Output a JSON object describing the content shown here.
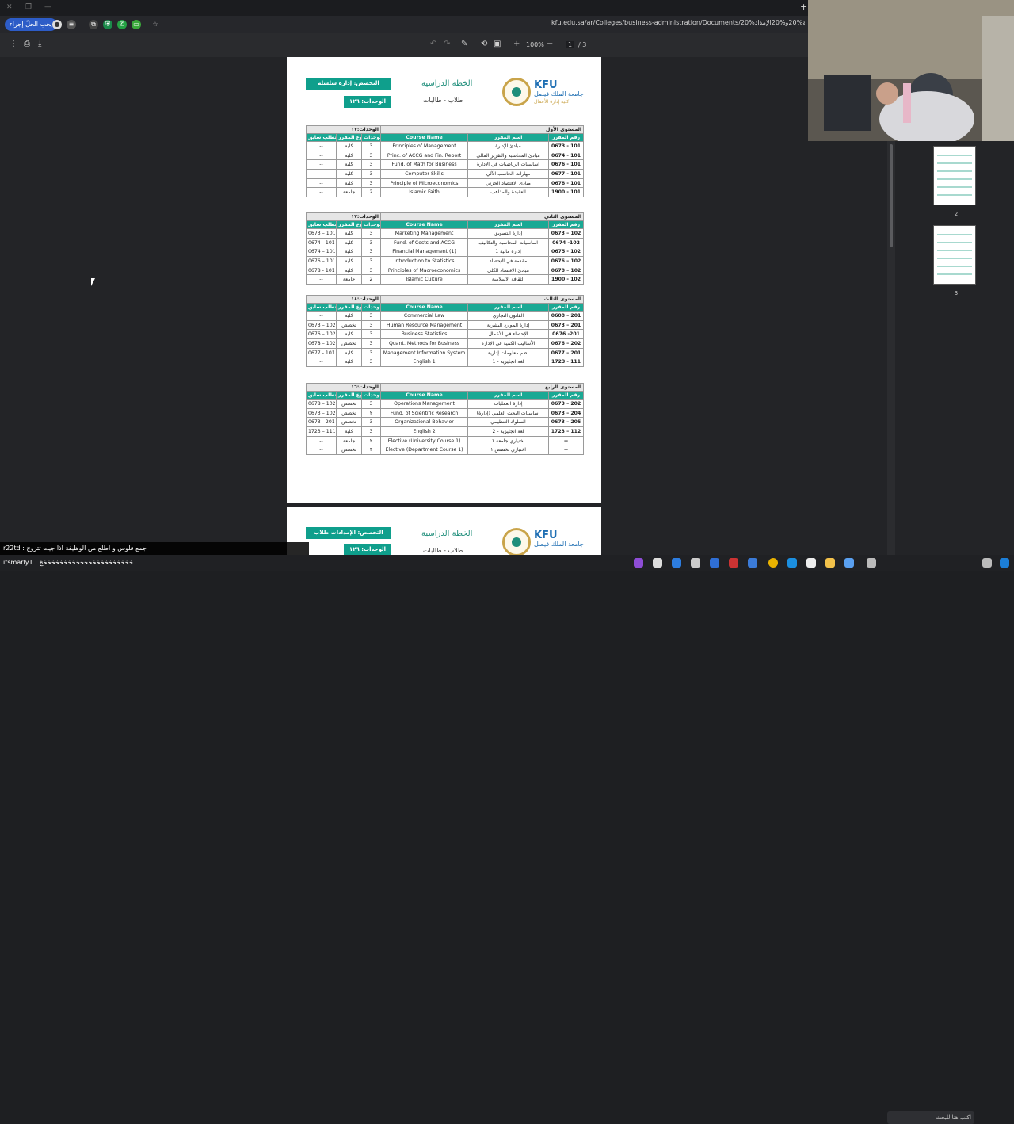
{
  "browser": {
    "tab_plus": "+",
    "url": "kfu.edu.sa/ar/Colleges/business-administration/Documents/الاعتماد%20خطة%20و%20الإمداد%20...",
    "pill_label": "يجب الحلّ إجراء",
    "star": "☆"
  },
  "pdf_toolbar": {
    "zoom": "100%",
    "page_current": "1",
    "page_total": "/ 3",
    "plus": "+",
    "minus": "−"
  },
  "page1": {
    "logo_en": "KFU",
    "logo_ar": "جامعة الملك فيصل",
    "logo_ar_sub": "كلية إدارة الأعمال",
    "plan_title": "الخطة الدراسية",
    "plan_sub": "طلاب - طالبات",
    "specialization": "التخصص: إدارة سلسلة الإمدادات",
    "units": "الوحدات: ١٢٦"
  },
  "col_headers": {
    "code": "رقم المقرر",
    "name_ar": "اسم المقرر",
    "name_en": "Course Name",
    "units": "الوحدات",
    "type": "نوع المقرر",
    "prereq": "متطلب سابق"
  },
  "levels": [
    {
      "title": "المستوى الأول",
      "units": "الوحدات:١٧",
      "rows": [
        {
          "code": "0673 - 101",
          "ar": "مبادئ الإدارة",
          "en": "Principles of Management",
          "u": "3",
          "type": "كلية",
          "pre": "--"
        },
        {
          "code": "0674 - 101",
          "ar": "مبادئ المحاسبة والتقرير المالي",
          "en": "Princ. of ACCG and Fin. Report",
          "u": "3",
          "type": "كلية",
          "pre": "--"
        },
        {
          "code": "0676 - 101",
          "ar": "اساسيات الرياضيات في الادارة",
          "en": "Fund. of Math for Business",
          "u": "3",
          "type": "كلية",
          "pre": "--"
        },
        {
          "code": "0677 - 101",
          "ar": "مهارات الحاسب الآلي",
          "en": "Computer Skills",
          "u": "3",
          "type": "كلية",
          "pre": "--"
        },
        {
          "code": "0678 - 101",
          "ar": "مبادئ الاقتصاد الجزئي",
          "en": "Principle of Microeconomics",
          "u": "3",
          "type": "كلية",
          "pre": "--"
        },
        {
          "code": "1900 - 101",
          "ar": "العقيدة والمذاهب",
          "en": "Islamic Faith",
          "u": "2",
          "type": "جامعة",
          "pre": "--"
        }
      ]
    },
    {
      "title": "المستوى الثاني",
      "units": "الوحدات:١٧",
      "rows": [
        {
          "code": "0673 – 102",
          "ar": "إدارة التسويق",
          "en": "Marketing Management",
          "u": "3",
          "type": "كلية",
          "pre": "0673 – 101"
        },
        {
          "code": "0674 -102",
          "ar": "اساسيات المحاسبة والتكاليف",
          "en": "Fund. of Costs and ACCG",
          "u": "3",
          "type": "كلية",
          "pre": "0674 - 101"
        },
        {
          "code": "0675 - 102",
          "ar": "إدارة مالية 1",
          "en": "Financial Management (1)",
          "u": "3",
          "type": "كلية",
          "pre": "0674 – 101"
        },
        {
          "code": "0676 – 102",
          "ar": "مقدمة في الإحصاء",
          "en": "Introduction to Statistics",
          "u": "3",
          "type": "كلية",
          "pre": "0676 – 101"
        },
        {
          "code": "0678 – 102",
          "ar": "مبادئ الاقتصاد الكلي",
          "en": "Principles of Macroeconomics",
          "u": "3",
          "type": "كلية",
          "pre": "0678 - 101"
        },
        {
          "code": "1900 - 102",
          "ar": "الثقافة الاسلامية",
          "en": "Islamic Culture",
          "u": "2",
          "type": "جامعة",
          "pre": "--"
        }
      ]
    },
    {
      "title": "المستوى الثالث",
      "units": "الوحدات:١٨",
      "rows": [
        {
          "code": "0608 – 201",
          "ar": "القانون التجاري",
          "en": "Commercial Law",
          "u": "3",
          "type": "كلية",
          "pre": "--"
        },
        {
          "code": "0673 – 201",
          "ar": "إدارة الموارد البشرية",
          "en": "Human Resource Management",
          "u": "3",
          "type": "تخصص",
          "pre": "0673 – 102"
        },
        {
          "code": "0676 -201",
          "ar": "الإحصاء في الأعمال",
          "en": "Business Statistics",
          "u": "3",
          "type": "كلية",
          "pre": "0676 – 102"
        },
        {
          "code": "0676 – 202",
          "ar": "الأساليب الكمية في الإدارة",
          "en": "Quant. Methods for Business",
          "u": "3",
          "type": "تخصص",
          "pre": "0678 – 102"
        },
        {
          "code": "0677 – 201",
          "ar": "نظم معلومات إدارية",
          "en": "Management Information System",
          "u": "3",
          "type": "كلية",
          "pre": "0677 - 101"
        },
        {
          "code": "1723 - 111",
          "ar": "لغة انجليزية - 1",
          "en": "English 1",
          "u": "3",
          "type": "كلية",
          "pre": "--"
        }
      ]
    },
    {
      "title": "المستوى الرابع",
      "units": "الوحدات:١٦",
      "rows": [
        {
          "code": "0673 – 202",
          "ar": "إدارة العمليات",
          "en": "Operations Management",
          "u": "3",
          "type": "تخصص",
          "pre": "0678 – 102"
        },
        {
          "code": "0673 – 204",
          "ar": "اساسيات البحث العلمي (إدارة)",
          "en": "Fund. of Scientific Research",
          "u": "٢",
          "type": "تخصص",
          "pre": "0673 – 102"
        },
        {
          "code": "0673 – 205",
          "ar": "السلوك التنظيمي",
          "en": "Organizational Behavior",
          "u": "3",
          "type": "تخصص",
          "pre": "0673 - 201"
        },
        {
          "code": "1723 – 112",
          "ar": "لغة انجليزية - 2",
          "en": "English  2",
          "u": "3",
          "type": "كلية",
          "pre": "1723 – 111"
        },
        {
          "code": "--",
          "ar": "اختياري جامعة ١",
          "en": "Elective (University Course 1)",
          "u": "٢",
          "type": "جامعة",
          "pre": "--"
        },
        {
          "code": "--",
          "ar": "اختياري تخصص ١",
          "en": "Elective (Department Course 1)",
          "u": "٣",
          "type": "تخصص",
          "pre": "--"
        }
      ]
    }
  ],
  "page2": {
    "specialization": "التخصص: الإمدادات طلاب",
    "units": "الوحدات: ١٢٦"
  },
  "thumbnails": [
    {
      "label": "2"
    },
    {
      "label": "3"
    }
  ],
  "chat": {
    "line1": "r22td : جمع فلوس و اطلع من الوظيفة اذا جيت تتزوج",
    "line2": "itsmarly1 : خخخخخخخخخخخخخخخخخخخخخخخ"
  },
  "taskbar": {
    "search_placeholder": "اكتب هنا للبحث"
  }
}
